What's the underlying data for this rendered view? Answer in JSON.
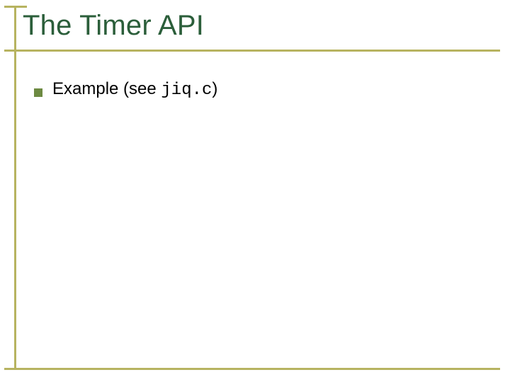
{
  "slide": {
    "title": "The Timer API",
    "bullets": [
      {
        "text_prefix": "Example (see ",
        "code": "jiq.c",
        "text_suffix": ")"
      }
    ]
  },
  "theme": {
    "accent": "#b7b360",
    "title_color": "#2B5E3A",
    "bullet_color": "#6d8a42"
  }
}
